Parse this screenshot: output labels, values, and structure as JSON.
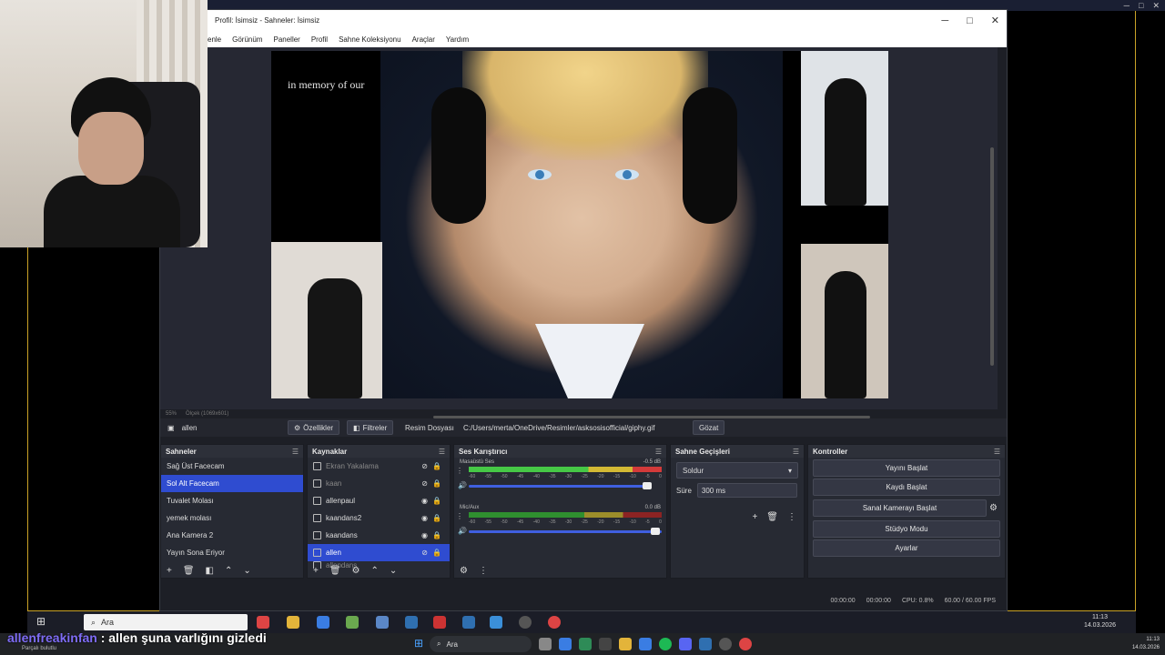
{
  "obs": {
    "title": "Profil: İsimsiz - Sahneler: İsimsiz",
    "menu": [
      "enle",
      "Görünüm",
      "Paneller",
      "Profil",
      "Sahne Koleksiyonu",
      "Araçlar",
      "Yardım"
    ],
    "preview_text": "in memory of our",
    "preview_status": {
      "zoom": "55%",
      "size": "Ölçek (1069x601)"
    },
    "source_toolbar": {
      "source_name": "allen",
      "properties": "Özellikler",
      "filters": "Filtreler",
      "image_file_label": "Resim Dosyası",
      "path": "C:/Users/merta/OneDrive/Resimler/asksosisofficial/giphy.gif",
      "browse": "Gözat"
    },
    "scenes": {
      "title": "Sahneler",
      "items": [
        "Sağ Üst Facecam",
        "Sol Alt Facecam",
        "Tuvalet Molası",
        "yemek molası",
        "Ana Kamera 2",
        "Yayın Sona Eriyor"
      ],
      "selected_index": 1
    },
    "sources": {
      "title": "Kaynaklar",
      "items": [
        {
          "label": "Ekran Yakalama",
          "visible": false
        },
        {
          "label": "kaan",
          "visible": false
        },
        {
          "label": "allenpaul",
          "visible": true
        },
        {
          "label": "kaandans2",
          "visible": true
        },
        {
          "label": "kaandans",
          "visible": true
        },
        {
          "label": "allen",
          "visible": false
        },
        {
          "label": "allendans",
          "visible": false
        }
      ],
      "selected_index": 5
    },
    "mixer": {
      "title": "Ses Karıştırıcı",
      "channels": [
        {
          "name": "Masaüstü Ses",
          "db": "-0.5 dB"
        },
        {
          "name": "Mic/Aux",
          "db": "0.0 dB"
        }
      ],
      "scale": [
        "-60",
        "-55",
        "-50",
        "-45",
        "-40",
        "-35",
        "-30",
        "-25",
        "-20",
        "-15",
        "-10",
        "-5",
        "0"
      ]
    },
    "transitions": {
      "title": "Sahne Geçişleri",
      "selected": "Soldur",
      "duration_label": "Süre",
      "duration": "300 ms"
    },
    "controls": {
      "title": "Kontroller",
      "buttons": [
        "Yayını Başlat",
        "Kaydı Başlat",
        "Sanal Kamerayı Başlat",
        "Stüdyo Modu",
        "Ayarlar"
      ]
    },
    "statusbar": {
      "time1": "00:00:00",
      "time2": "00:00:00",
      "cpu": "CPU: 0.8%",
      "fps": "60.00 / 60.00 FPS"
    }
  },
  "inner_taskbar": {
    "search_placeholder": "Ara",
    "time": "11:13",
    "date": "14.03.2026"
  },
  "chat": {
    "user": "allenfreakinfan",
    "message": " : allen şuna varlığını gizledi",
    "sub": "Parçalı bulutlu"
  },
  "outer_taskbar": {
    "search_placeholder": "Ara",
    "time": "11:13",
    "date": "14.03.2026"
  }
}
